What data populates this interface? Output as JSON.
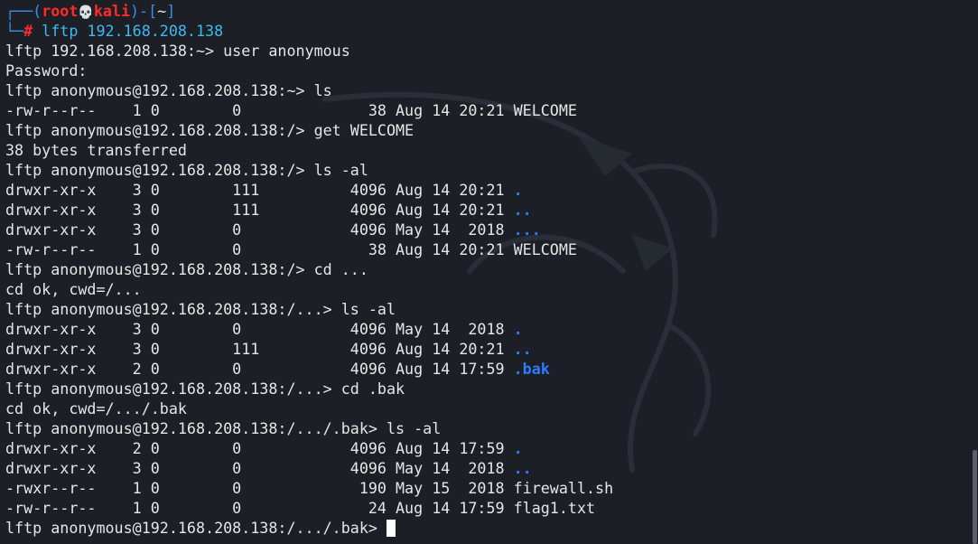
{
  "prompt": {
    "top_bracket": "┌──(",
    "user": "root",
    "skull": "💀",
    "host": "kali",
    "dir_open": ")-[",
    "dir": "~",
    "dir_close": "]",
    "bottom": "└─",
    "hash": "#",
    "command": " lftp 192.168.208.138"
  },
  "lines": [
    "lftp 192.168.208.138:~> user anonymous",
    "Password:",
    "lftp anonymous@192.168.208.138:~> ls",
    "-rw-r--r--    1 0        0              38 Aug 14 20:21 WELCOME",
    "lftp anonymous@192.168.208.138:/> get WELCOME",
    "38 bytes transferred",
    "lftp anonymous@192.168.208.138:/> ls -al",
    "drwxr-xr-x    3 0        111          4096 Aug 14 20:21 ",
    "drwxr-xr-x    3 0        111          4096 Aug 14 20:21 ",
    "drwxr-xr-x    3 0        0            4096 May 14  2018 ",
    "-rw-r--r--    1 0        0              38 Aug 14 20:21 WELCOME",
    "lftp anonymous@192.168.208.138:/> cd ...",
    "cd ok, cwd=/...",
    "lftp anonymous@192.168.208.138:/...> ls -al",
    "drwxr-xr-x    3 0        0            4096 May 14  2018 ",
    "drwxr-xr-x    3 0        111          4096 Aug 14 20:21 ",
    "drwxr-xr-x    2 0        0            4096 Aug 14 17:59 ",
    "lftp anonymous@192.168.208.138:/...> cd .bak",
    "cd ok, cwd=/.../.bak",
    "lftp anonymous@192.168.208.138:/.../.bak> ls -al",
    "drwxr-xr-x    2 0        0            4096 Aug 14 17:59 ",
    "drwxr-xr-x    3 0        0            4096 May 14  2018 ",
    "-rwxr--r--    1 0        0             190 May 15  2018 firewall.sh",
    "-rw-r--r--    1 0        0              24 Aug 14 17:59 flag1.txt",
    "lftp anonymous@192.168.208.138:/.../.bak> "
  ],
  "dir_names": {
    "7": ".",
    "8": "..",
    "9": "...",
    "14": ".",
    "15": "..",
    "16": ".bak",
    "20": ".",
    "21": ".."
  },
  "colors": {
    "background": "#1c1f26",
    "text": "#e6e6e6",
    "prompt_frame": "#3b8eea",
    "root_user": "#ff2a2a",
    "directory": "#2e7bff"
  }
}
